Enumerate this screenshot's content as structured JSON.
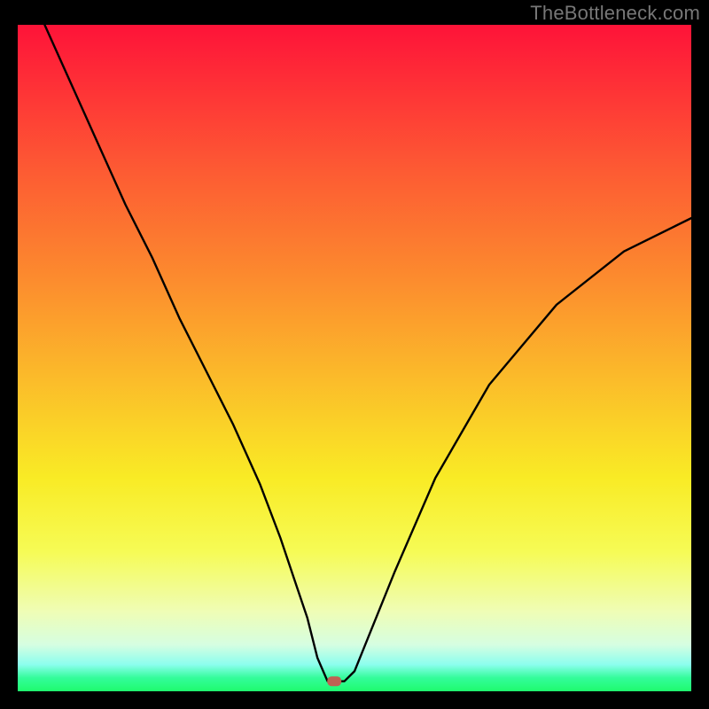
{
  "watermark": "TheBottleneck.com",
  "chart_data": {
    "type": "line",
    "title": "",
    "xlabel": "",
    "ylabel": "",
    "xlim": [
      0,
      100
    ],
    "ylim": [
      0,
      100
    ],
    "grid": false,
    "legend": false,
    "annotations": [],
    "series": [
      {
        "name": "bottleneck-curve",
        "x": [
          4,
          8,
          12,
          16,
          20,
          24,
          28,
          32,
          36,
          39,
          41,
          43,
          44.5,
          46,
          48.5,
          50,
          52,
          56,
          62,
          70,
          80,
          90,
          100
        ],
        "values": [
          100,
          91,
          82,
          73,
          65,
          56,
          48,
          40,
          31,
          23,
          17,
          11,
          5,
          1.5,
          1.5,
          3,
          8,
          18,
          32,
          46,
          58,
          66,
          71
        ]
      }
    ],
    "marker": {
      "x": 47,
      "y": 1.5
    },
    "colors": {
      "curve": "#000000",
      "marker": "#BE6153",
      "gradient_top": "#FE1338",
      "gradient_bottom": "#1FFB6E"
    }
  }
}
